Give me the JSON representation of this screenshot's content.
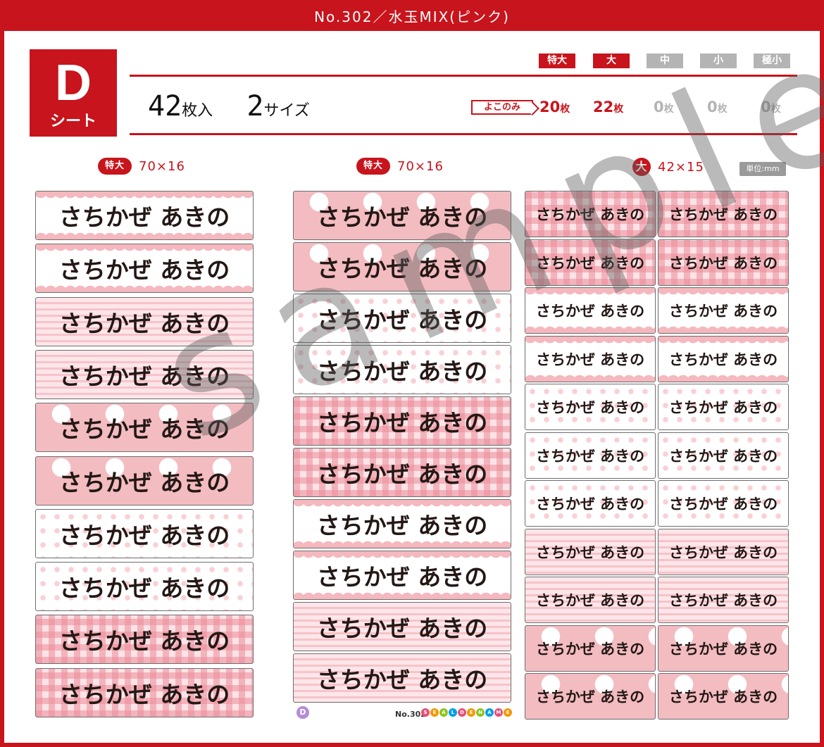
{
  "title": "No.302／水玉MIX(ピンク)",
  "sheet": {
    "letter": "D",
    "type": "シート"
  },
  "summary": {
    "count": "42",
    "count_unit": "枚入",
    "sizes": "2",
    "sizes_unit": "サイズ"
  },
  "size_chips": [
    {
      "label": "特大",
      "active": true
    },
    {
      "label": "大",
      "active": true
    },
    {
      "label": "中",
      "active": false
    },
    {
      "label": "小",
      "active": false
    },
    {
      "label": "極小",
      "active": false
    }
  ],
  "yoko_label": "よこのみ",
  "quantities": [
    {
      "num": "20",
      "unit": "枚",
      "active": true
    },
    {
      "num": "22",
      "unit": "枚",
      "active": true
    },
    {
      "num": "0",
      "unit": "枚",
      "active": false
    },
    {
      "num": "0",
      "unit": "枚",
      "active": false
    },
    {
      "num": "0",
      "unit": "枚",
      "active": false
    }
  ],
  "columns": [
    {
      "badge": "特大",
      "dims": "70×16"
    },
    {
      "badge": "特大",
      "dims": "70×16"
    },
    {
      "badge": "大",
      "dims": "42×15"
    }
  ],
  "unit_label": "単位:mm",
  "label_text": "さちかぜ あきの",
  "col1_patterns": [
    "scallop",
    "scallop",
    "stripe",
    "stripe",
    "bigdot",
    "bigdot",
    "smalldot",
    "smalldot",
    "gingham",
    "gingham"
  ],
  "col2_patterns": [
    "bigdot",
    "bigdot",
    "smalldot",
    "smalldot",
    "gingham",
    "gingham",
    "scallop",
    "scallop",
    "stripe",
    "stripe"
  ],
  "col3_patterns": [
    "gingham",
    "gingham",
    "scallop",
    "scallop",
    "smalldot",
    "smalldot",
    "smalldot",
    "stripe",
    "stripe",
    "bigdot",
    "bigdot"
  ],
  "watermark": "sample",
  "footer": {
    "badge": "D",
    "number": "No.302",
    "brand": "SEALDENAME"
  },
  "colors": {
    "accent": "#c8141c",
    "inactive": "#b4b4b4",
    "pink": "#f3bcc1"
  }
}
